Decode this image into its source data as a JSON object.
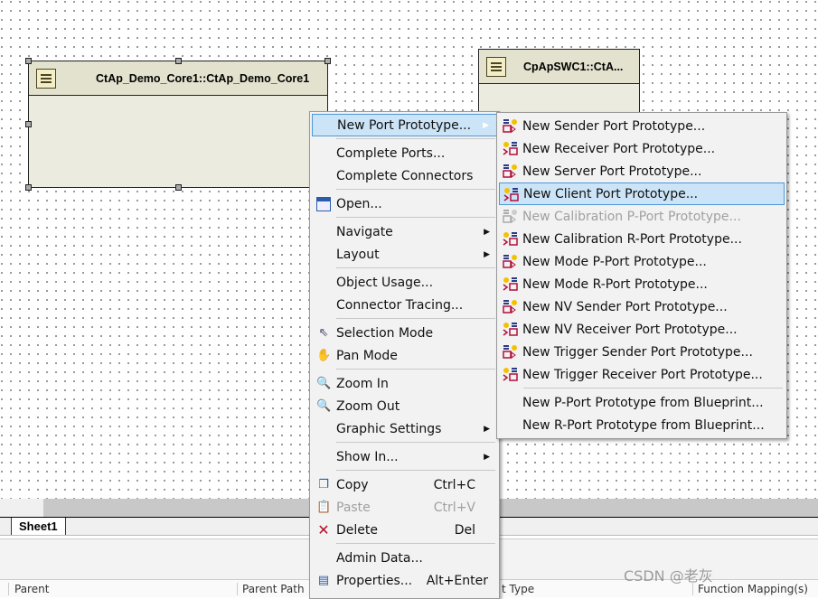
{
  "diagram": {
    "components": [
      {
        "title": "CtAp_Demo_Core1::CtAp_Demo_Core1"
      },
      {
        "title": "CpApSWC1::CtA..."
      }
    ]
  },
  "context_menu": {
    "items": [
      {
        "label": "New Port Prototype...",
        "submenu": true,
        "highlighted": true
      },
      {
        "label": "Complete Ports..."
      },
      {
        "label": "Complete Connectors"
      },
      {
        "label": "Open...",
        "icon": "open-editor-icon"
      },
      {
        "label": "Navigate",
        "submenu": true
      },
      {
        "label": "Layout",
        "submenu": true
      },
      {
        "label": "Object Usage..."
      },
      {
        "label": "Connector Tracing..."
      },
      {
        "label": "Selection Mode",
        "icon": "pointer-icon"
      },
      {
        "label": "Pan Mode",
        "icon": "hand-icon"
      },
      {
        "label": "Zoom In",
        "icon": "zoom-in-icon"
      },
      {
        "label": "Zoom Out",
        "icon": "zoom-out-icon"
      },
      {
        "label": "Graphic Settings",
        "submenu": true
      },
      {
        "label": "Show In...",
        "submenu": true
      },
      {
        "label": "Copy",
        "shortcut": "Ctrl+C",
        "icon": "copy-icon"
      },
      {
        "label": "Paste",
        "shortcut": "Ctrl+V",
        "icon": "paste-icon",
        "disabled": true
      },
      {
        "label": "Delete",
        "shortcut": "Del",
        "icon": "delete-icon"
      },
      {
        "label": "Admin Data..."
      },
      {
        "label": "Properties...",
        "shortcut": "Alt+Enter",
        "icon": "properties-icon"
      }
    ]
  },
  "submenu": {
    "items": [
      {
        "label": "New Sender Port Prototype..."
      },
      {
        "label": "New Receiver Port Prototype..."
      },
      {
        "label": "New Server Port Prototype..."
      },
      {
        "label": "New Client Port Prototype...",
        "highlighted": true
      },
      {
        "label": "New Calibration P-Port Prototype...",
        "disabled": true
      },
      {
        "label": "New Calibration R-Port Prototype..."
      },
      {
        "label": "New Mode P-Port Prototype..."
      },
      {
        "label": "New Mode R-Port Prototype..."
      },
      {
        "label": "New NV Sender Port Prototype..."
      },
      {
        "label": "New NV Receiver Port Prototype..."
      },
      {
        "label": "New Trigger Sender Port Prototype..."
      },
      {
        "label": "New Trigger Receiver Port Prototype..."
      },
      {
        "label": "New P-Port Prototype from Blueprint..."
      },
      {
        "label": "New R-Port Prototype from Blueprint..."
      }
    ]
  },
  "sheet_tabs": [
    {
      "label": "Sheet1"
    }
  ],
  "table": {
    "columns": [
      "Parent",
      "Parent Path",
      "t Type",
      "Function Mapping(s)"
    ]
  },
  "watermark": "CSDN @老灰"
}
